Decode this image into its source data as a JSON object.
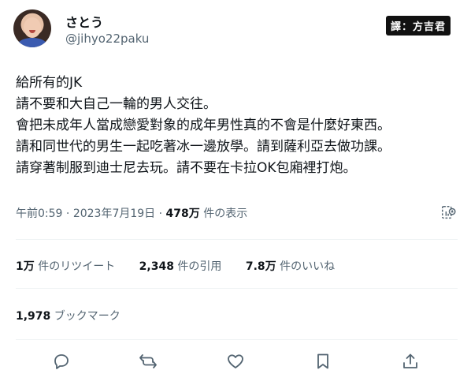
{
  "user": {
    "display_name": "さとう",
    "handle": "@jihyo22paku"
  },
  "badge": "譯：方吉君",
  "tweet": {
    "lines": [
      "給所有的JK",
      "請不要和大自己一輪的男人交往。",
      "會把未成年人當成戀愛對象的成年男性真的不會是什麼好東西。",
      "請和同世代的男生一起吃著冰一邊放學。請到薩利亞去做功課。",
      "請穿著制服到迪士尼去玩。請不要在卡拉OK包廂裡打炮。"
    ]
  },
  "meta": {
    "time": "午前0:59",
    "date": "2023年7月19日",
    "views": "478万",
    "views_suffix": "件の表示",
    "sep": "·"
  },
  "stats": {
    "retweets_count": "1万",
    "retweets_label": "件のリツイート",
    "quotes_count": "2,348",
    "quotes_label": "件の引用",
    "likes_count": "7.8万",
    "likes_label": "件のいいね",
    "bookmarks_count": "1,978",
    "bookmarks_label": "ブックマーク"
  },
  "icons": {
    "reply": "reply-icon",
    "retweet": "retweet-icon",
    "like": "heart-icon",
    "bookmark": "bookmark-icon",
    "share": "share-icon",
    "analytics": "analytics-icon"
  },
  "colors": {
    "text": "#0f1419",
    "secondary": "#536471",
    "divider": "#eff3f4"
  }
}
